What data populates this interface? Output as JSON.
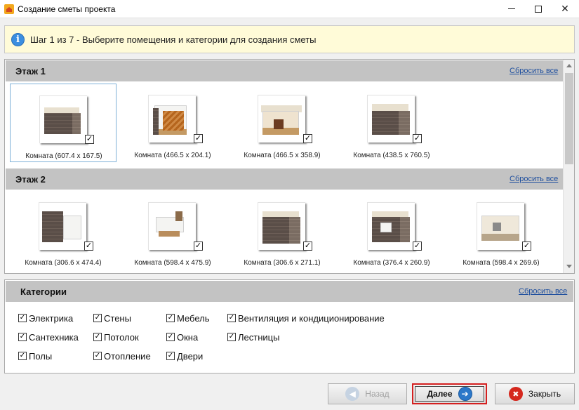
{
  "window": {
    "title": "Создание сметы проекта",
    "minimize_glyph": "",
    "close_glyph": "✕"
  },
  "info": {
    "text": "Шаг 1 из 7 - Выберите помещения и категории для создания сметы",
    "icon": "info-icon"
  },
  "floors": [
    {
      "title": "Этаж 1",
      "reset_label": "Сбросить все",
      "rooms": [
        {
          "caption": "Комната (607.4 x 167.5)",
          "checked": true,
          "selected": true
        },
        {
          "caption": "Комната (466.5 x 204.1)",
          "checked": true
        },
        {
          "caption": "Комната (466.5 x 358.9)",
          "checked": true
        },
        {
          "caption": "Комната (438.5 x 760.5)",
          "checked": true
        }
      ]
    },
    {
      "title": "Этаж 2",
      "reset_label": "Сбросить все",
      "rooms": [
        {
          "caption": "Комната (306.6 x 474.4)",
          "checked": true
        },
        {
          "caption": "Комната (598.4 x 475.9)",
          "checked": true
        },
        {
          "caption": "Комната (306.6 x 271.1)",
          "checked": true
        },
        {
          "caption": "Комната (376.4 x 260.9)",
          "checked": true
        },
        {
          "caption": "Комната (598.4 x 269.6)",
          "checked": true
        }
      ]
    }
  ],
  "categories": {
    "title": "Категории",
    "reset_label": "Сбросить все",
    "items": [
      {
        "label": "Электрика",
        "checked": true
      },
      {
        "label": "Стены",
        "checked": true
      },
      {
        "label": "Мебель",
        "checked": true
      },
      {
        "label": "Вентиляция и кондиционирование",
        "checked": true
      },
      {
        "label": "Сантехника",
        "checked": true
      },
      {
        "label": "Потолок",
        "checked": true
      },
      {
        "label": "Окна",
        "checked": true
      },
      {
        "label": "Лестницы",
        "checked": true
      },
      {
        "label": "Полы",
        "checked": true
      },
      {
        "label": "Отопление",
        "checked": true
      },
      {
        "label": "Двери",
        "checked": true
      }
    ]
  },
  "buttons": {
    "back_label": "Назад",
    "back_enabled": false,
    "next_label": "Далее",
    "close_label": "Закрыть"
  },
  "checkmark": "✓",
  "colors": {
    "info_background": "#fffbd8",
    "section_header": "#c3c3c3",
    "link": "#1f4f9e",
    "highlight_border": "#d42020"
  }
}
